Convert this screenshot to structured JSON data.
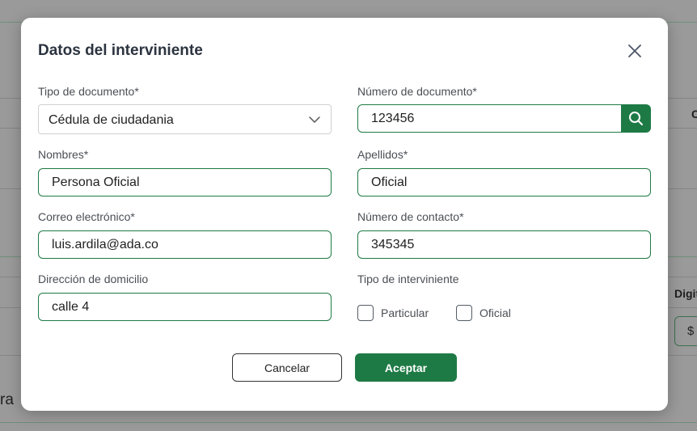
{
  "background": {
    "col_c": "C",
    "col_digit": "Digit",
    "pill": "$",
    "fragment_ra": "ra"
  },
  "modal": {
    "title": "Datos del interviniente",
    "fields": {
      "doc_type": {
        "label": "Tipo de documento*",
        "value": "Cédula de ciudadania"
      },
      "doc_number": {
        "label": "Número de documento*",
        "value": "123456"
      },
      "names": {
        "label": "Nombres*",
        "value": "Persona Oficial"
      },
      "surnames": {
        "label": "Apellidos*",
        "value": "Oficial"
      },
      "email": {
        "label": "Correo electrónico*",
        "value": "luis.ardila@ada.co"
      },
      "contact": {
        "label": "Número de contacto*",
        "value": "345345"
      },
      "address": {
        "label": "Dirección de domicilio",
        "value": "calle 4"
      },
      "intervener_type": {
        "label": "Tipo de interviniente",
        "options": [
          "Particular",
          "Oficial"
        ]
      }
    },
    "buttons": {
      "cancel": "Cancelar",
      "accept": "Aceptar"
    }
  },
  "colors": {
    "accent": "#1e7a45",
    "title": "#2c3440",
    "overlay": "#9a9a9a"
  },
  "icons": {
    "close": "close-icon",
    "search": "search-icon",
    "dropdown": "chevron-down-icon"
  }
}
